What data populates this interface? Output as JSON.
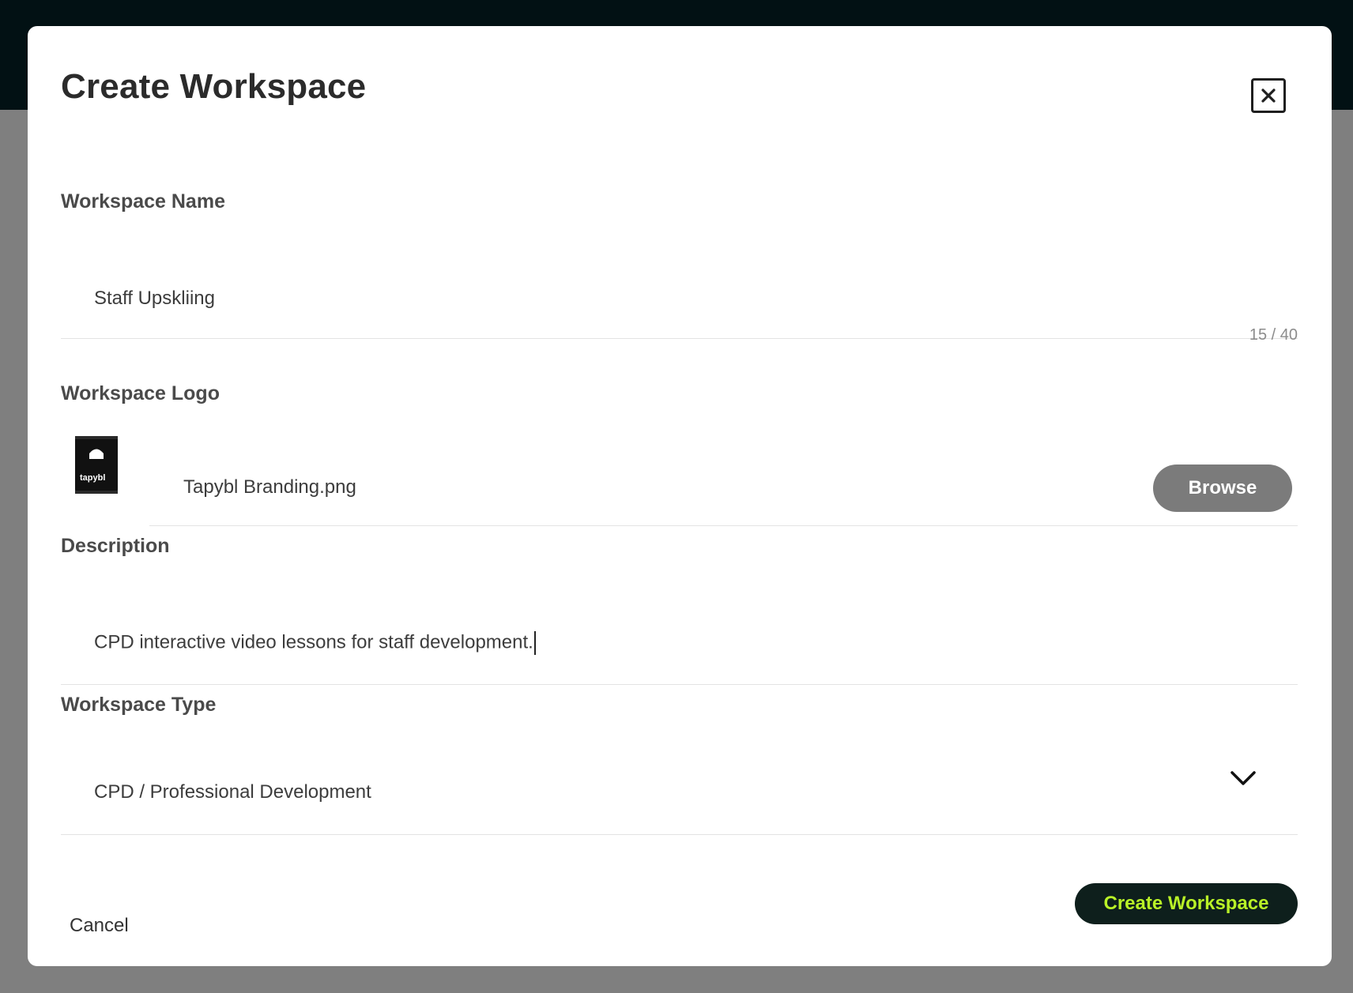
{
  "modal": {
    "title": "Create Workspace",
    "close_icon": "close-icon"
  },
  "workspace_name": {
    "label": "Workspace Name",
    "value": "Staff Upskliing",
    "counter": "15 / 40"
  },
  "workspace_logo": {
    "label": "Workspace Logo",
    "thumbnail_text": "tapybl",
    "filename": "Tapybl Branding.png",
    "browse_label": "Browse"
  },
  "description": {
    "label": "Description",
    "value": "CPD interactive video lessons for staff development."
  },
  "workspace_type": {
    "label": "Workspace Type",
    "selected": "CPD / Professional Development",
    "icon": "chevron-down-icon"
  },
  "footer": {
    "cancel_label": "Cancel",
    "create_label": "Create Workspace"
  },
  "colors": {
    "topbar": "#021114",
    "backdrop": "#7f7f7f",
    "primary_button_bg": "#0e1f1c",
    "primary_button_text": "#b9f227",
    "browse_button_bg": "#7b7b7b"
  }
}
